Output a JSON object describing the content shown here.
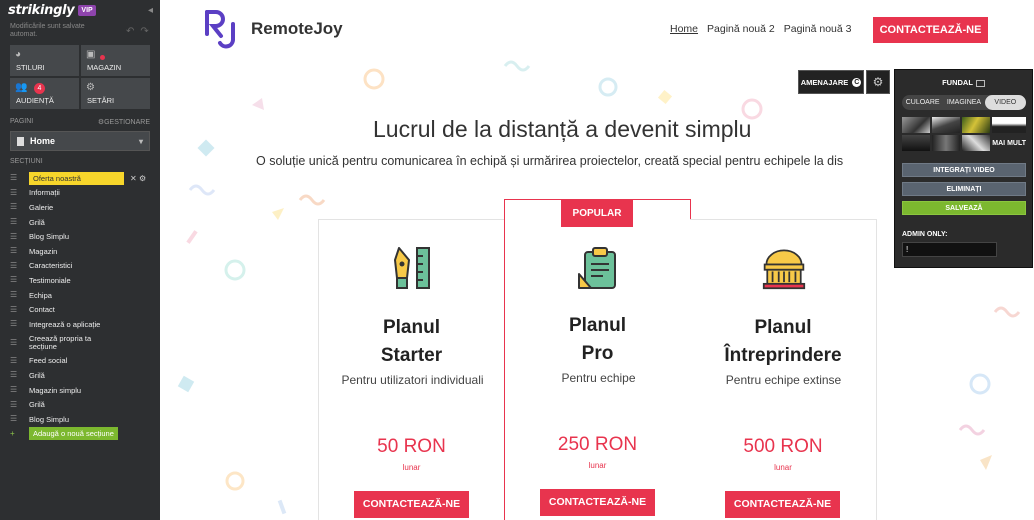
{
  "sidebar": {
    "logo": "strikingly",
    "vip": "VIP",
    "autosave": "Modificările sunt salvate automat.",
    "tools": [
      {
        "label": "STILURI",
        "icon": "palette-icon"
      },
      {
        "label": "MAGAZIN",
        "icon": "shopping-bag-icon"
      },
      {
        "label": "AUDIENȚĂ",
        "icon": "people-icon",
        "badge": "4"
      },
      {
        "label": "SETĂRI",
        "icon": "gear-icon"
      }
    ],
    "pages_label": "PAGINI",
    "manage_label": "GESTIONARE",
    "current_page": "Home",
    "sections_label": "SECȚIUNI",
    "sections": [
      "Oferta noastră",
      "Informații",
      "Galerie",
      "Grilă",
      "Blog Simplu",
      "Magazin",
      "Caracteristici",
      "Testimoniale",
      "Echipa",
      "Contact",
      "Integrează o aplicație",
      "Creează propria ta secțiune",
      "Feed social",
      "Grilă",
      "Magazin simplu",
      "Grilă",
      "Blog Simplu"
    ],
    "add_section": "Adaugă o nouă secțiune"
  },
  "site": {
    "name": "RemoteJoy",
    "nav": [
      "Home",
      "Pagină nouă 2",
      "Pagină nouă 3"
    ],
    "cta": "CONTACTEAZĂ-NE",
    "hero_title": "Lucrul de la distanță a devenit simplu",
    "hero_subtitle": "O soluție unică pentru comunicarea în echipă și urmărirea proiectelor, creată special pentru echipele la dis",
    "plans": [
      {
        "name_line1": "Planul",
        "name_line2": "Starter",
        "desc": "Pentru utilizatori individuali",
        "price": "50 RON",
        "period": "lunar",
        "button": "CONTACTEAZĂ-NE"
      },
      {
        "name_line1": "Planul",
        "name_line2": "Pro",
        "desc": "Pentru echipe",
        "price": "250 RON",
        "period": "lunar",
        "button": "CONTACTEAZĂ-NE",
        "badge": "POPULAR"
      },
      {
        "name_line1": "Planul",
        "name_line2": "Întreprindere",
        "desc": "Pentru echipe extinse",
        "price": "500 RON",
        "period": "lunar",
        "button": "CONTACTEAZĂ-NE"
      }
    ]
  },
  "editor": {
    "layout_label": "AMENAJARE",
    "layout_badge": "C",
    "bg_title": "FUNDAL",
    "bg_tabs": [
      "CULOARE",
      "IMAGINEA",
      "VIDEO"
    ],
    "bg_tab_selected": "VIDEO",
    "more_label": "MAI MULT",
    "integrate_video": "INTEGRAȚI VIDEO",
    "remove": "ELIMINAȚI",
    "save": "SALVEAZĂ",
    "admin_label": "ADMIN ONLY:",
    "admin_value": "!"
  },
  "colors": {
    "accent": "#e8344e",
    "sidebar_bg": "#2d2f31",
    "active_section": "#f7d62b",
    "add_green": "#7cb82f",
    "logo_purple": "#5b3fc4"
  }
}
